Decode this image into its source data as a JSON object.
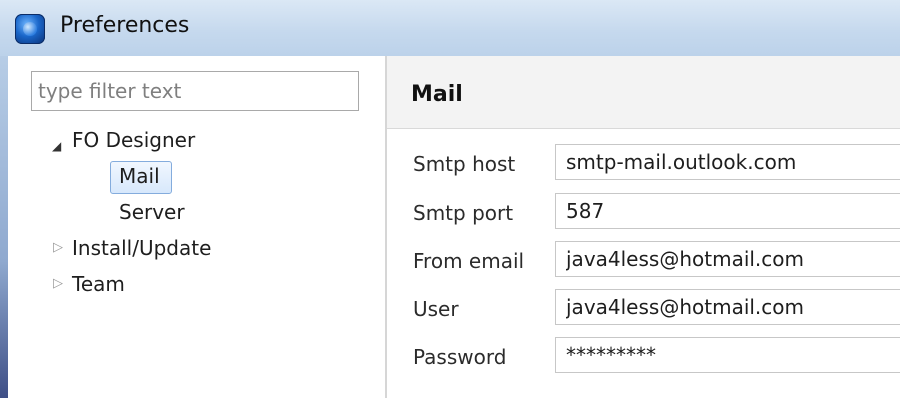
{
  "window": {
    "title": "Preferences",
    "icon": "app-globe-icon"
  },
  "filter": {
    "placeholder": "type filter text",
    "value": ""
  },
  "tree": [
    {
      "label": "FO Designer",
      "expanded": true,
      "children": [
        {
          "label": "Mail",
          "selected": true
        },
        {
          "label": "Server",
          "selected": false
        }
      ]
    },
    {
      "label": "Install/Update",
      "expanded": false
    },
    {
      "label": "Team",
      "expanded": false
    }
  ],
  "page": {
    "title": "Mail",
    "fields": [
      {
        "label": "Smtp host",
        "value": "smtp-mail.outlook.com"
      },
      {
        "label": "Smtp port",
        "value": "587"
      },
      {
        "label": "From email",
        "value": "java4less@hotmail.com"
      },
      {
        "label": "User",
        "value": "java4less@hotmail.com"
      },
      {
        "label": "Password",
        "value": "*********"
      }
    ]
  },
  "colors": {
    "titlebar": "#c6d9ee",
    "selection_border": "#84acdd",
    "selection_fill": "#d7e8fc"
  }
}
